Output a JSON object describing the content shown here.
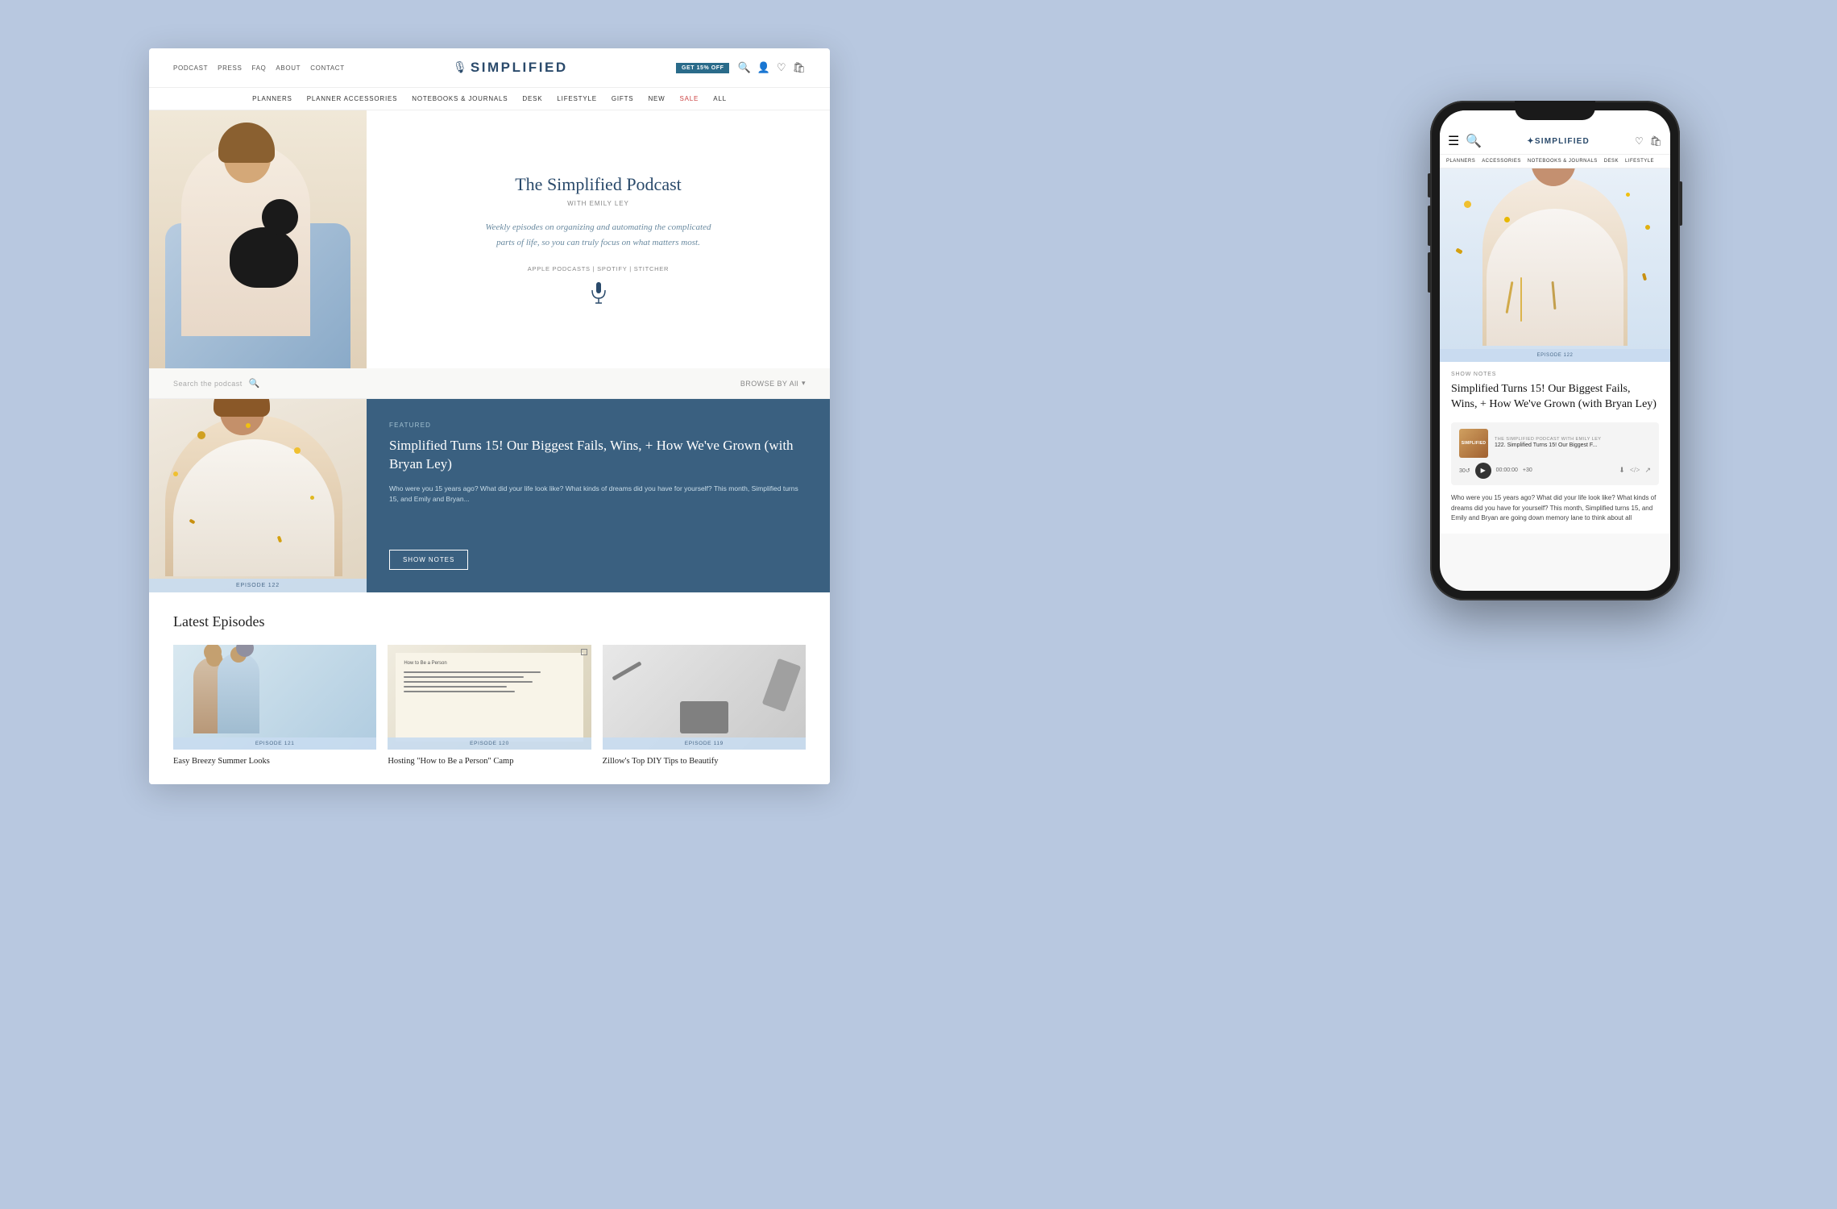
{
  "background": {
    "color": "#b8c8e0"
  },
  "desktop": {
    "top_nav": {
      "links": [
        "PODCAST",
        "PRESS",
        "FAQ",
        "ABOUT",
        "CONTACT"
      ],
      "logo": "✦SIMPLIFIED",
      "discount_badge": "GET 15% OFF",
      "icons": [
        "🔍",
        "👤",
        "♡",
        "🛍"
      ]
    },
    "main_nav": {
      "items": [
        "PLANNERS",
        "PLANNER ACCESSORIES",
        "NOTEBOOKS & JOURNALS",
        "DESK",
        "LIFESTYLE",
        "GIFTS",
        "NEW",
        "SALE",
        "ALL"
      ]
    },
    "hero": {
      "podcast_title": "The Simplified Podcast",
      "podcast_author": "WITH EMILY LEY",
      "podcast_desc": "Weekly episodes on organizing and automating the complicated parts of life, so you can truly focus on what matters most.",
      "platform_links": "APPLE PODCASTS | SPOTIFY | STITCHER"
    },
    "search": {
      "placeholder": "Search the podcast",
      "browse_label": "BROWSE BY All"
    },
    "featured": {
      "label": "FEATURED",
      "title": "Simplified Turns 15! Our Biggest Fails, Wins, + How We've Grown (with Bryan Ley)",
      "description": "Who were you 15 years ago? What did your life look like? What kinds of dreams did you have for yourself? This month, Simplified turns 15, and Emily and Bryan...",
      "show_notes_btn": "SHOW NOTES",
      "episode": "EPISODE 122"
    },
    "latest_episodes": {
      "section_title": "Latest Episodes",
      "episodes": [
        {
          "title": "Easy Breezy Summer Looks",
          "episode": "EPISODE 121"
        },
        {
          "title": "Hosting \"How to Be a Person\" Camp",
          "episode": "EPISODE 120"
        },
        {
          "title": "Zillow's Top DIY Tips to Beautify",
          "episode": "EPISODE 119"
        }
      ]
    }
  },
  "mobile": {
    "nav": {
      "logo": "✦SIMPLIFIED",
      "icons": [
        "☰",
        "🔍",
        "♡",
        "🛍"
      ]
    },
    "main_nav": {
      "items": [
        "PLANNERS",
        "ACCESSORIES",
        "NOTEBOOKS & JOURNALS",
        "DESK",
        "LIFESTYLE"
      ]
    },
    "episode_badge": "EPISODE 122",
    "show_notes_label": "SHOW NOTES",
    "episode_title": "Simplified Turns 15! Our Biggest Fails, Wins, + How We've Grown (with Bryan Ley)",
    "audio": {
      "thumbnail_text": "SIMPLIFIED",
      "podcast_name": "THE SIMPLIFIED PODCAST WITH EMILY LEY",
      "episode_name": "122. Simplified Turns 15! Our Biggest F...",
      "back_30": "30↺",
      "time": "00:00:00",
      "forward_30": "+30",
      "icons": [
        "⬇",
        "</>",
        "🔄"
      ]
    },
    "description": "Who were you 15 years ago? What did your life look like? What kinds of dreams did you have for yourself? This month, Simplified turns 15, and Emily and Bryan are going down memory lane to think about all"
  }
}
